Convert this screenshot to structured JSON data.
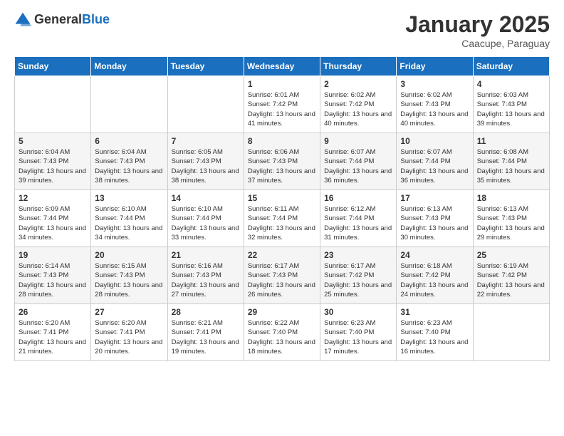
{
  "logo": {
    "general": "General",
    "blue": "Blue"
  },
  "header": {
    "month": "January 2025",
    "location": "Caacupe, Paraguay"
  },
  "weekdays": [
    "Sunday",
    "Monday",
    "Tuesday",
    "Wednesday",
    "Thursday",
    "Friday",
    "Saturday"
  ],
  "weeks": [
    [
      {
        "day": "",
        "info": ""
      },
      {
        "day": "",
        "info": ""
      },
      {
        "day": "",
        "info": ""
      },
      {
        "day": "1",
        "info": "Sunrise: 6:01 AM\nSunset: 7:42 PM\nDaylight: 13 hours and 41 minutes."
      },
      {
        "day": "2",
        "info": "Sunrise: 6:02 AM\nSunset: 7:42 PM\nDaylight: 13 hours and 40 minutes."
      },
      {
        "day": "3",
        "info": "Sunrise: 6:02 AM\nSunset: 7:43 PM\nDaylight: 13 hours and 40 minutes."
      },
      {
        "day": "4",
        "info": "Sunrise: 6:03 AM\nSunset: 7:43 PM\nDaylight: 13 hours and 39 minutes."
      }
    ],
    [
      {
        "day": "5",
        "info": "Sunrise: 6:04 AM\nSunset: 7:43 PM\nDaylight: 13 hours and 39 minutes."
      },
      {
        "day": "6",
        "info": "Sunrise: 6:04 AM\nSunset: 7:43 PM\nDaylight: 13 hours and 38 minutes."
      },
      {
        "day": "7",
        "info": "Sunrise: 6:05 AM\nSunset: 7:43 PM\nDaylight: 13 hours and 38 minutes."
      },
      {
        "day": "8",
        "info": "Sunrise: 6:06 AM\nSunset: 7:43 PM\nDaylight: 13 hours and 37 minutes."
      },
      {
        "day": "9",
        "info": "Sunrise: 6:07 AM\nSunset: 7:44 PM\nDaylight: 13 hours and 36 minutes."
      },
      {
        "day": "10",
        "info": "Sunrise: 6:07 AM\nSunset: 7:44 PM\nDaylight: 13 hours and 36 minutes."
      },
      {
        "day": "11",
        "info": "Sunrise: 6:08 AM\nSunset: 7:44 PM\nDaylight: 13 hours and 35 minutes."
      }
    ],
    [
      {
        "day": "12",
        "info": "Sunrise: 6:09 AM\nSunset: 7:44 PM\nDaylight: 13 hours and 34 minutes."
      },
      {
        "day": "13",
        "info": "Sunrise: 6:10 AM\nSunset: 7:44 PM\nDaylight: 13 hours and 34 minutes."
      },
      {
        "day": "14",
        "info": "Sunrise: 6:10 AM\nSunset: 7:44 PM\nDaylight: 13 hours and 33 minutes."
      },
      {
        "day": "15",
        "info": "Sunrise: 6:11 AM\nSunset: 7:44 PM\nDaylight: 13 hours and 32 minutes."
      },
      {
        "day": "16",
        "info": "Sunrise: 6:12 AM\nSunset: 7:44 PM\nDaylight: 13 hours and 31 minutes."
      },
      {
        "day": "17",
        "info": "Sunrise: 6:13 AM\nSunset: 7:43 PM\nDaylight: 13 hours and 30 minutes."
      },
      {
        "day": "18",
        "info": "Sunrise: 6:13 AM\nSunset: 7:43 PM\nDaylight: 13 hours and 29 minutes."
      }
    ],
    [
      {
        "day": "19",
        "info": "Sunrise: 6:14 AM\nSunset: 7:43 PM\nDaylight: 13 hours and 28 minutes."
      },
      {
        "day": "20",
        "info": "Sunrise: 6:15 AM\nSunset: 7:43 PM\nDaylight: 13 hours and 28 minutes."
      },
      {
        "day": "21",
        "info": "Sunrise: 6:16 AM\nSunset: 7:43 PM\nDaylight: 13 hours and 27 minutes."
      },
      {
        "day": "22",
        "info": "Sunrise: 6:17 AM\nSunset: 7:43 PM\nDaylight: 13 hours and 26 minutes."
      },
      {
        "day": "23",
        "info": "Sunrise: 6:17 AM\nSunset: 7:42 PM\nDaylight: 13 hours and 25 minutes."
      },
      {
        "day": "24",
        "info": "Sunrise: 6:18 AM\nSunset: 7:42 PM\nDaylight: 13 hours and 24 minutes."
      },
      {
        "day": "25",
        "info": "Sunrise: 6:19 AM\nSunset: 7:42 PM\nDaylight: 13 hours and 22 minutes."
      }
    ],
    [
      {
        "day": "26",
        "info": "Sunrise: 6:20 AM\nSunset: 7:41 PM\nDaylight: 13 hours and 21 minutes."
      },
      {
        "day": "27",
        "info": "Sunrise: 6:20 AM\nSunset: 7:41 PM\nDaylight: 13 hours and 20 minutes."
      },
      {
        "day": "28",
        "info": "Sunrise: 6:21 AM\nSunset: 7:41 PM\nDaylight: 13 hours and 19 minutes."
      },
      {
        "day": "29",
        "info": "Sunrise: 6:22 AM\nSunset: 7:40 PM\nDaylight: 13 hours and 18 minutes."
      },
      {
        "day": "30",
        "info": "Sunrise: 6:23 AM\nSunset: 7:40 PM\nDaylight: 13 hours and 17 minutes."
      },
      {
        "day": "31",
        "info": "Sunrise: 6:23 AM\nSunset: 7:40 PM\nDaylight: 13 hours and 16 minutes."
      },
      {
        "day": "",
        "info": ""
      }
    ]
  ]
}
